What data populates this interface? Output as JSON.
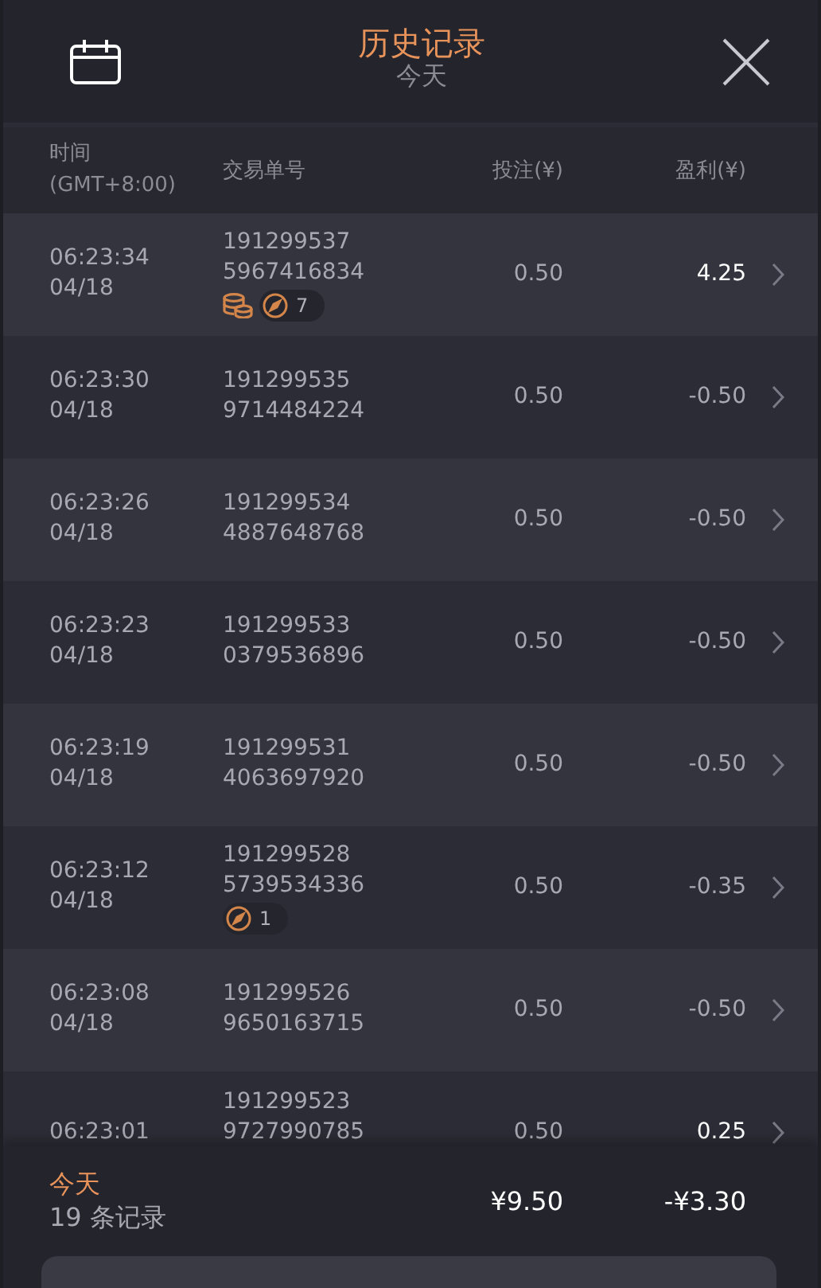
{
  "header": {
    "title": "历史记录",
    "subtitle": "今天"
  },
  "columns": {
    "time": [
      "时间",
      "(GMT+8:00)"
    ],
    "order": "交易单号",
    "bet": "投注(¥)",
    "profit": "盈利(¥)"
  },
  "rows": [
    {
      "time": "06:23:34",
      "date": "04/18",
      "order": [
        "191299537",
        "5967416834"
      ],
      "bet": "0.50",
      "profit": "4.25",
      "win": true,
      "badges": [
        {
          "kind": "coins"
        },
        {
          "kind": "spins",
          "count": "7"
        }
      ]
    },
    {
      "time": "06:23:30",
      "date": "04/18",
      "order": [
        "191299535",
        "9714484224"
      ],
      "bet": "0.50",
      "profit": "-0.50",
      "win": false,
      "badges": []
    },
    {
      "time": "06:23:26",
      "date": "04/18",
      "order": [
        "191299534",
        "4887648768"
      ],
      "bet": "0.50",
      "profit": "-0.50",
      "win": false,
      "badges": []
    },
    {
      "time": "06:23:23",
      "date": "04/18",
      "order": [
        "191299533",
        "0379536896"
      ],
      "bet": "0.50",
      "profit": "-0.50",
      "win": false,
      "badges": []
    },
    {
      "time": "06:23:19",
      "date": "04/18",
      "order": [
        "191299531",
        "4063697920"
      ],
      "bet": "0.50",
      "profit": "-0.50",
      "win": false,
      "badges": []
    },
    {
      "time": "06:23:12",
      "date": "04/18",
      "order": [
        "191299528",
        "5739534336"
      ],
      "bet": "0.50",
      "profit": "-0.35",
      "win": false,
      "badges": [
        {
          "kind": "spins",
          "count": "1"
        }
      ]
    },
    {
      "time": "06:23:08",
      "date": "04/18",
      "order": [
        "191299526",
        "9650163715"
      ],
      "bet": "0.50",
      "profit": "-0.50",
      "win": false,
      "badges": []
    },
    {
      "time": "06:23:01",
      "order": [
        "191299523",
        "9727990785"
      ],
      "bet": "0.50",
      "profit": "0.25",
      "win": true,
      "badges": []
    }
  ],
  "footer": {
    "period": "今天",
    "count": "19 条记录",
    "total_bet": "¥9.50",
    "total_profit": "-¥3.30"
  }
}
